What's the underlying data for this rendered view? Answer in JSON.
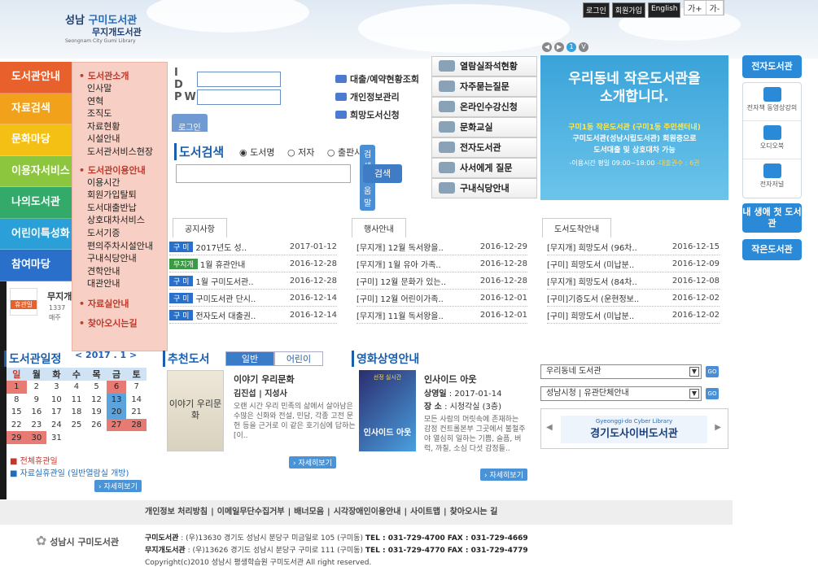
{
  "header": {
    "logo_line1_a": "성남",
    "logo_line1_b": "구미도서관",
    "logo_line2": "무지개도서관",
    "logo_line3": "Seongnam City Gumi Library",
    "links": [
      "로그인",
      "회원가입",
      "English"
    ],
    "font_controls": [
      "가+",
      "가-"
    ]
  },
  "gnb": [
    {
      "label": "도서관안내",
      "color": "#e8602c"
    },
    {
      "label": "자료검색",
      "color": "#f1a21a"
    },
    {
      "label": "문화마당",
      "color": "#f4c013"
    },
    {
      "label": "이용자서비스",
      "color": "#8cc63f"
    },
    {
      "label": "나의도서관",
      "color": "#33aa6a"
    },
    {
      "label": "어린이특성화",
      "color": "#2a9fd8"
    },
    {
      "label": "참여마당",
      "color": "#2a6fc9"
    }
  ],
  "lnb": {
    "group1": "도서관소개",
    "items1": [
      "인사말",
      "연혁",
      "조직도",
      "자료현황",
      "시설안내",
      "도서관서비스현장"
    ],
    "group2": "도서관이용안내",
    "items2": [
      "이용시간",
      "회원가입탈퇴",
      "도서대출반납",
      "상호대차서비스",
      "도서기증",
      "편의주차시설안내",
      "구내식당안내",
      "견학안내",
      "대관안내"
    ],
    "group3": "자료실안내",
    "group4": "찾아오시는길"
  },
  "login": {
    "id_label": "I D",
    "pw_label": "PW",
    "btn": "로그인"
  },
  "quick": [
    "대출/예약현황조회",
    "개인정보관리",
    "희망도서신청"
  ],
  "search": {
    "title": "도서검색",
    "options": [
      "도서명",
      "저자",
      "출판사"
    ],
    "guide": "검색도움말",
    "button": "검색"
  },
  "services": [
    "열람실좌석현황",
    "자주묻는질문",
    "온라인수강신청",
    "문화교실",
    "전자도서관",
    "사서에게 질문",
    "구내식당안내"
  ],
  "pager": [
    "1",
    "V"
  ],
  "banner": {
    "title1": "우리동네 작은도서관을",
    "title2": "소개합니다.",
    "sub1": "구미1동 작은도서관 (구미1동 주민센터내)",
    "sub2": "구미도서관(성남시립도서관) 회원증으로",
    "sub3": "도서대출 및 상호대차 가능",
    "hours_a": "-이용시간 평일 09:00~18:00",
    "hours_b": "-대출권수 : 6권"
  },
  "right": {
    "e_library": "전자도서관",
    "items": [
      "전자책 동영상강의",
      "오디오북",
      "전자저널"
    ],
    "first_library": "내 생애 첫 도서관",
    "small_library": "작은도서관"
  },
  "boards": {
    "notice": {
      "title": "공지사항",
      "rows": [
        {
          "cat": "구 미",
          "t": "2017년도 성..",
          "d": "2017-01-12"
        },
        {
          "cat": "무지개",
          "t": "1월 휴관안내",
          "d": "2016-12-28"
        },
        {
          "cat": "구 미",
          "t": "1월 구미도서관..",
          "d": "2016-12-28"
        },
        {
          "cat": "구 미",
          "t": "구미도서관 단시..",
          "d": "2016-12-14"
        },
        {
          "cat": "구 미",
          "t": "전자도서 대출권..",
          "d": "2016-12-14"
        }
      ]
    },
    "events": {
      "title": "행사안내",
      "rows": [
        {
          "t": "[무지개] 12월 독서왕을..",
          "d": "2016-12-29"
        },
        {
          "t": "[무지개] 1월 유아 가족..",
          "d": "2016-12-28"
        },
        {
          "t": "[구미] 12월 문화가 있는..",
          "d": "2016-12-28"
        },
        {
          "t": "[구미] 12월 어린이가족..",
          "d": "2016-12-01"
        },
        {
          "t": "[무지개] 11월 독서왕을..",
          "d": "2016-12-01"
        }
      ]
    },
    "arrivals": {
      "title": "도서도착안내",
      "rows": [
        {
          "t": "[무지개] 희망도서 (96차..",
          "d": "2016-12-15"
        },
        {
          "t": "[구미] 희망도서 (미납분..",
          "d": "2016-12-09"
        },
        {
          "t": "[무지개] 희망도서 (84차..",
          "d": "2016-12-08"
        },
        {
          "t": "[구미]기증도서 (운현정보..",
          "d": "2016-12-02"
        },
        {
          "t": "[구미] 희망도서 (미납분..",
          "d": "2016-12-02"
        }
      ]
    }
  },
  "notice_box": {
    "title": "무지개",
    "line1": "1337",
    "line2": "매주",
    "badge": "휴관일"
  },
  "calendar": {
    "title": "도서관일정",
    "month": "< 2017 . 1 >",
    "days": [
      "일",
      "월",
      "화",
      "수",
      "목",
      "금",
      "토"
    ],
    "weeks": [
      [
        "1",
        "2",
        "3",
        "4",
        "5",
        "6",
        "7"
      ],
      [
        "8",
        "9",
        "10",
        "11",
        "12",
        "13",
        "14"
      ],
      [
        "15",
        "16",
        "17",
        "18",
        "19",
        "20",
        "21"
      ],
      [
        "22",
        "23",
        "24",
        "25",
        "26",
        "27",
        "28"
      ],
      [
        "29",
        "30",
        "31",
        "",
        "",
        "",
        ""
      ]
    ],
    "legend_a": "전체휴관일",
    "legend_b": "자료실휴관일 (일반열람실 개방)",
    "more": "자세히보기"
  },
  "recommend": {
    "title": "추천도서",
    "tabs": [
      "일반",
      "어린이"
    ],
    "book_title": "이야기 우리문화",
    "author": "김진섭 | 지성사",
    "desc": "오랜 시간 우리 민족의 삶에서 살아남은 수많은 신화와 전설, 민담, 각종 고전 문헌 등을 근거로 이 같은 호기심에 답하는 [이..",
    "more": "자세히보기",
    "cover_text": "이야기 우리문화"
  },
  "movie": {
    "title": "영화상영안내",
    "movie_title": "인사이드 아웃",
    "date_label": "상영일",
    "date": "2017-01-14",
    "place_label": "장 소",
    "place": "시청각실 (3층)",
    "desc": "모든 사람의 머릿속에 존재하는 감정 컨트롤본부 그곳에서 불철주야 열심히 일하는 기쁨, 슬픔, 버럭, 까칠, 소심 다섯 감정들..",
    "more": "자세히보기",
    "poster_top": "선정 실시간",
    "poster_text": "인사이드 아웃"
  },
  "selects": [
    "우리동네 도서관",
    "성남시청 | 유관단체안내"
  ],
  "go": "GO",
  "cyber": {
    "small": "Gyeonggi-do Cyber Library",
    "big": "경기도사이버도서관"
  },
  "footer": {
    "nav": [
      "개인정보 처리방침",
      "이메일무단수집거부",
      "배너모음",
      "시각장애인이용안내",
      "사이트맵",
      "찾아오시는 길"
    ],
    "logo": "성남시 구미도서관",
    "gumi_label": "구미도서관",
    "gumi_addr": ": (우)13630 경기도 성남시 분당구 미금일로 105 (구미동)",
    "gumi_tel": "TEL : 031-729-4700",
    "gumi_fax": "FAX : 031-729-4669",
    "rainbow_label": "무지개도서관",
    "rainbow_addr": ": (우)13626 경기도 성남시 분당구 구미로 111 (구미동)",
    "rainbow_tel": "TEL : 031-729-4770",
    "rainbow_fax": "FAX : 031-729-4779",
    "copyright": "Copyright(c)2010 성남시 평생학습원 구미도서관 All right reserved."
  }
}
